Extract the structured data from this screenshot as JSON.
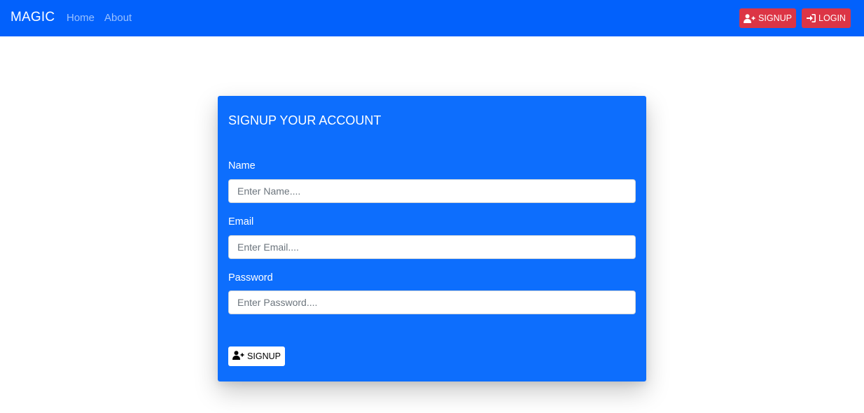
{
  "navbar": {
    "brand": "MAGIC",
    "links": [
      {
        "label": "Home"
      },
      {
        "label": "About"
      }
    ],
    "buttons": {
      "signup_label": "SIGNUP",
      "signup_icon": "user-plus-icon",
      "login_label": "LOGIN",
      "login_icon": "sign-in-icon"
    },
    "colors": {
      "background": "#0261fc",
      "button": "#dc3545"
    }
  },
  "form": {
    "title": "SIGNUP YOUR ACCOUNT",
    "fields": [
      {
        "label": "Name",
        "placeholder": "Enter Name....",
        "value": ""
      },
      {
        "label": "Email",
        "placeholder": "Enter Email....",
        "value": ""
      },
      {
        "label": "Password",
        "placeholder": "Enter Password....",
        "value": ""
      }
    ],
    "submit_label": "SIGNUP",
    "submit_icon": "user-plus-icon",
    "colors": {
      "background": "#0d6efd"
    }
  }
}
